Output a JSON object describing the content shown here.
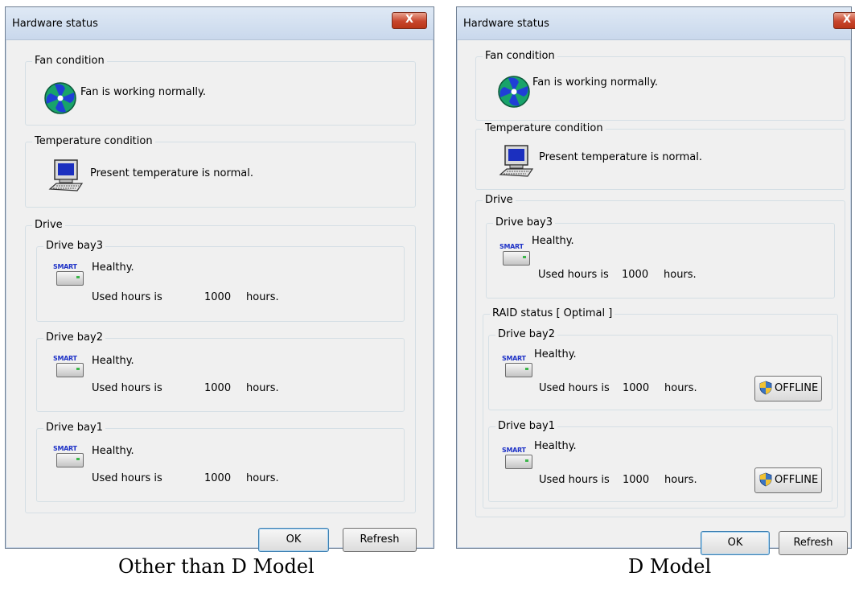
{
  "window_a": {
    "title": "Hardware status",
    "close": "X",
    "fan": {
      "group": "Fan condition",
      "message": "Fan is working normally."
    },
    "temperature": {
      "group": "Temperature condition",
      "message": "Present temperature is normal."
    },
    "drive": {
      "group": "Drive",
      "bays": [
        {
          "label": "Drive bay3",
          "status": "Healthy.",
          "used_label": "Used hours is",
          "hours": "1000",
          "unit": "hours."
        },
        {
          "label": "Drive bay2",
          "status": "Healthy.",
          "used_label": "Used hours is",
          "hours": "1000",
          "unit": "hours."
        },
        {
          "label": "Drive bay1",
          "status": "Healthy.",
          "used_label": "Used hours is",
          "hours": "1000",
          "unit": "hours."
        }
      ]
    },
    "ok": "OK",
    "refresh": "Refresh"
  },
  "window_b": {
    "title": "Hardware status",
    "close": "X",
    "fan": {
      "group": "Fan condition",
      "message": "Fan is working normally."
    },
    "temperature": {
      "group": "Temperature condition",
      "message": "Present temperature is normal."
    },
    "drive": {
      "group": "Drive",
      "bay3": {
        "label": "Drive bay3",
        "status": "Healthy.",
        "used_label": "Used hours is",
        "hours": "1000",
        "unit": "hours."
      },
      "raid": {
        "group": "RAID status [ Optimal ]",
        "bays": [
          {
            "label": "Drive bay2",
            "status": "Healthy.",
            "used_label": "Used hours is",
            "hours": "1000",
            "unit": "hours.",
            "offline": "OFFLINE"
          },
          {
            "label": "Drive bay1",
            "status": "Healthy.",
            "used_label": "Used hours is",
            "hours": "1000",
            "unit": "hours.",
            "offline": "OFFLINE"
          }
        ]
      }
    },
    "ok": "OK",
    "refresh": "Refresh"
  },
  "captions": {
    "left": "Other than D Model",
    "right": "D Model"
  },
  "colors": {
    "window_bg": "#f0f0f0",
    "close_button": "#c7452c",
    "smart_text": "#1f33c7",
    "default_button_border": "#3c7fb1"
  }
}
